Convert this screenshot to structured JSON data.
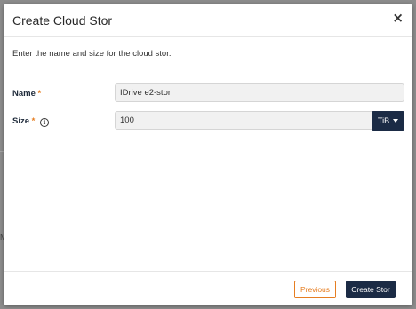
{
  "modal": {
    "title": "Create Cloud Stor",
    "close_glyph": "×",
    "description": "Enter the name and size for the cloud stor."
  },
  "form": {
    "name": {
      "label": "Name",
      "required_mark": "*",
      "value": "IDrive e2-stor"
    },
    "size": {
      "label": "Size",
      "required_mark": "*",
      "info_glyph": "i",
      "value": "100",
      "unit": "TiB"
    }
  },
  "footer": {
    "previous_label": "Previous",
    "create_label": "Create Stor"
  },
  "background": {
    "fragment": "M"
  },
  "colors": {
    "primary": "#1b2b45",
    "accent": "#e67e22"
  }
}
